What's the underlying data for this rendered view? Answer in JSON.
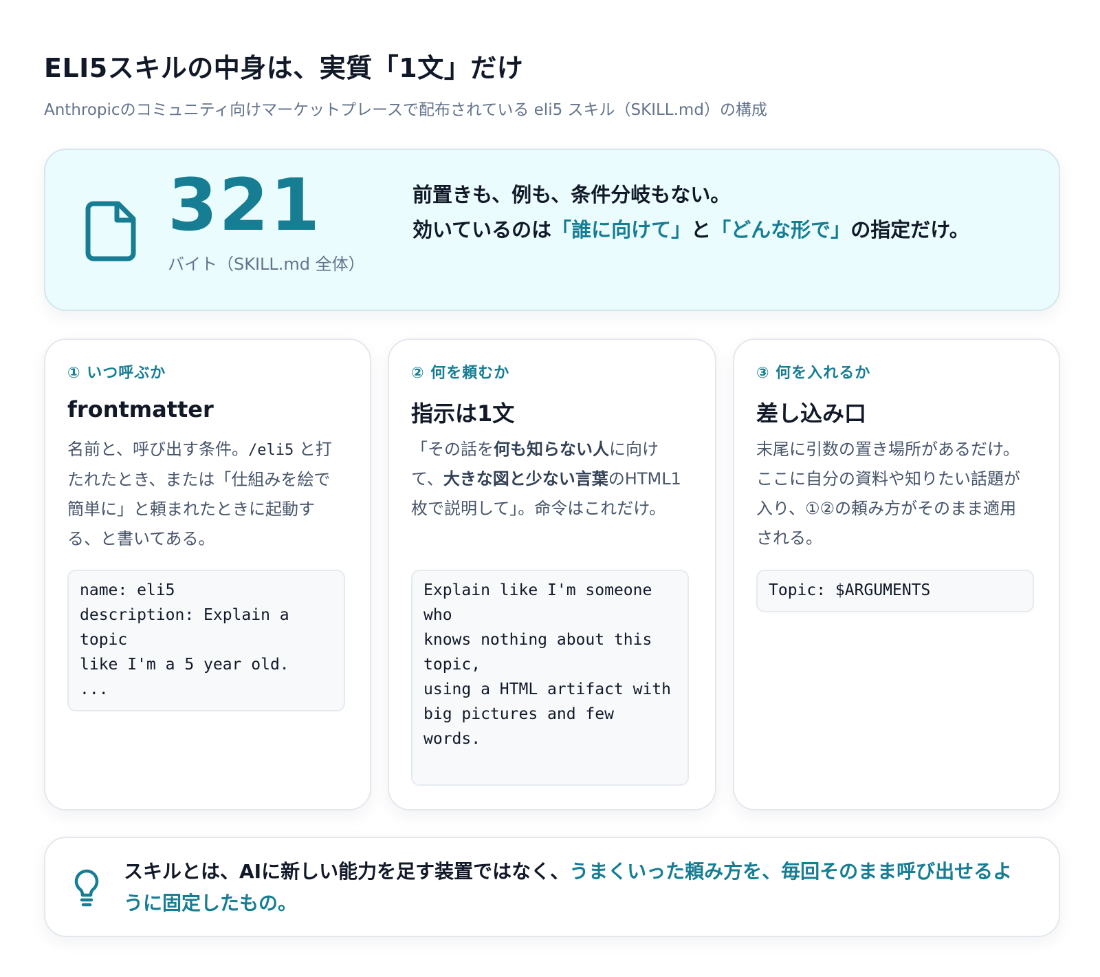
{
  "header": {
    "title": "ELI5スキルの中身は、実質「1文」だけ",
    "subtitle": "Anthropicのコミュニティ向けマーケットプレースで配布されている eli5 スキル（SKILL.md）の構成"
  },
  "hero": {
    "icon": "document-icon",
    "number": "321",
    "caption": "バイト（SKILL.md 全体）",
    "line1": "前置きも、例も、条件分岐もない。",
    "line2_prefix": "効いているのは",
    "line2_accent1": "「誰に向けて」",
    "line2_mid": "と",
    "line2_accent2": "「どんな形で」",
    "line2_suffix": "の指定だけ。"
  },
  "cards": [
    {
      "eyebrow": "① いつ呼ぶか",
      "title": "frontmatter",
      "body": {
        "part1": "名前と、呼び出す条件。",
        "code": "/eli5",
        "part2": " と打たれたとき、または「仕組みを絵で簡単に」と頼まれたときに起動する、と書いてある。"
      },
      "code": "name: eli5\ndescription: Explain a topic\nlike I'm a 5 year old.\n..."
    },
    {
      "eyebrow": "② 何を頼むか",
      "title": "指示は1文",
      "body": {
        "part1": "「その話を",
        "bold1": "何も知らない人",
        "part2": "に向けて、",
        "bold2": "大きな図と少ない言葉",
        "part3": "のHTML1枚で説明して」。命令はこれだけ。"
      },
      "code": "Explain like I'm someone who\nknows nothing about this topic,\nusing a HTML artifact with\nbig pictures and few words."
    },
    {
      "eyebrow": "③ 何を入れるか",
      "title": "差し込み口",
      "body": {
        "part1": "末尾に引数の置き場所があるだけ。ここに自分の資料や知りたい話題が入り、①②の頼み方がそのまま適用される。"
      },
      "code": "Topic: $ARGUMENTS"
    }
  ],
  "takeaway": {
    "icon": "lightbulb-icon",
    "text_plain": "スキルとは、AIに新しい能力を足す装置ではなく、",
    "text_accent": "うまくいった頼み方を、毎回そのまま呼び出せるように固定したもの。"
  },
  "colors": {
    "accent": "#167d93",
    "hero_bg": "#ebfcfe",
    "text": "#111827",
    "muted": "#64748b"
  }
}
